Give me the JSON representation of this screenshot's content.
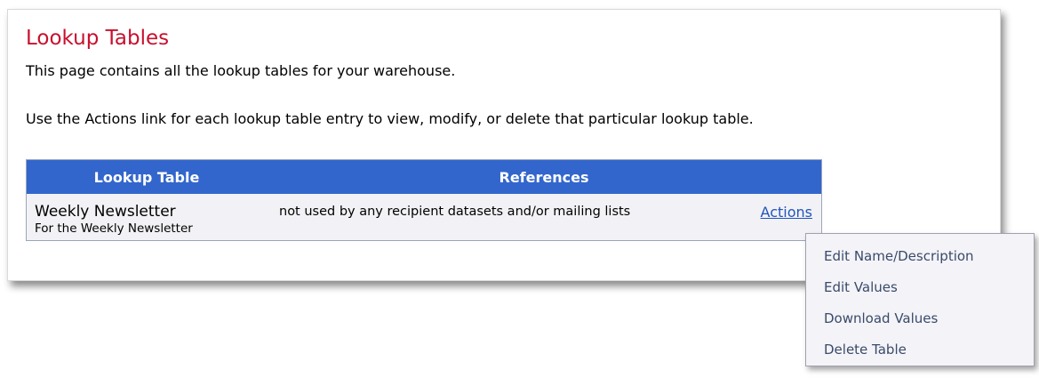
{
  "page": {
    "title": "Lookup Tables",
    "intro": "This page contains all the lookup tables for your warehouse.",
    "instructions": "Use the Actions link for each lookup table entry to view, modify, or delete that particular lookup table."
  },
  "table": {
    "columns": [
      "Lookup Table",
      "References"
    ],
    "rows": [
      {
        "name": "Weekly Newsletter",
        "description": "For the Weekly Newsletter",
        "references": "not used by any recipient datasets and/or mailing lists",
        "actions_label": "Actions"
      }
    ]
  },
  "actions_menu": {
    "items": [
      "Edit Name/Description",
      "Edit Values",
      "Download Values",
      "Delete Table"
    ]
  },
  "colors": {
    "title": "#c8102e",
    "header_bg": "#3366cc",
    "link": "#2255bb"
  }
}
